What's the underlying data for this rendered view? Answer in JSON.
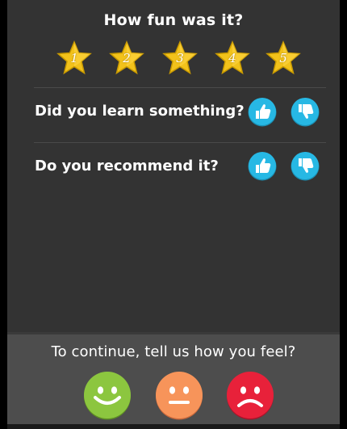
{
  "fun_rating": {
    "question": "How fun was it?",
    "stars": [
      {
        "label": "1",
        "icon": "star-icon"
      },
      {
        "label": "2",
        "icon": "star-icon"
      },
      {
        "label": "3",
        "icon": "star-icon"
      },
      {
        "label": "4",
        "icon": "star-icon"
      },
      {
        "label": "5",
        "icon": "star-icon"
      }
    ],
    "selected": 0
  },
  "learn_question": {
    "text": "Did you learn something?",
    "thumbs_up_icon": "thumbs-up-icon",
    "thumbs_down_icon": "thumbs-down-icon"
  },
  "recommend_question": {
    "text": "Do you recommend it?",
    "thumbs_up_icon": "thumbs-up-icon",
    "thumbs_down_icon": "thumbs-down-icon"
  },
  "feelings": {
    "prompt": "To continue, tell us how you feel?",
    "options": [
      {
        "mood": "happy",
        "icon": "happy-face-icon",
        "color": "#8cc63f"
      },
      {
        "mood": "neutral",
        "icon": "neutral-face-icon",
        "color": "#f7945a"
      },
      {
        "mood": "sad",
        "icon": "sad-face-icon",
        "color": "#e8213a"
      }
    ]
  },
  "colors": {
    "background": "#333333",
    "footer": "#4d4d4d",
    "star": "#f2c21b",
    "thumb": "#27b8e4",
    "text": "#ffffff"
  }
}
